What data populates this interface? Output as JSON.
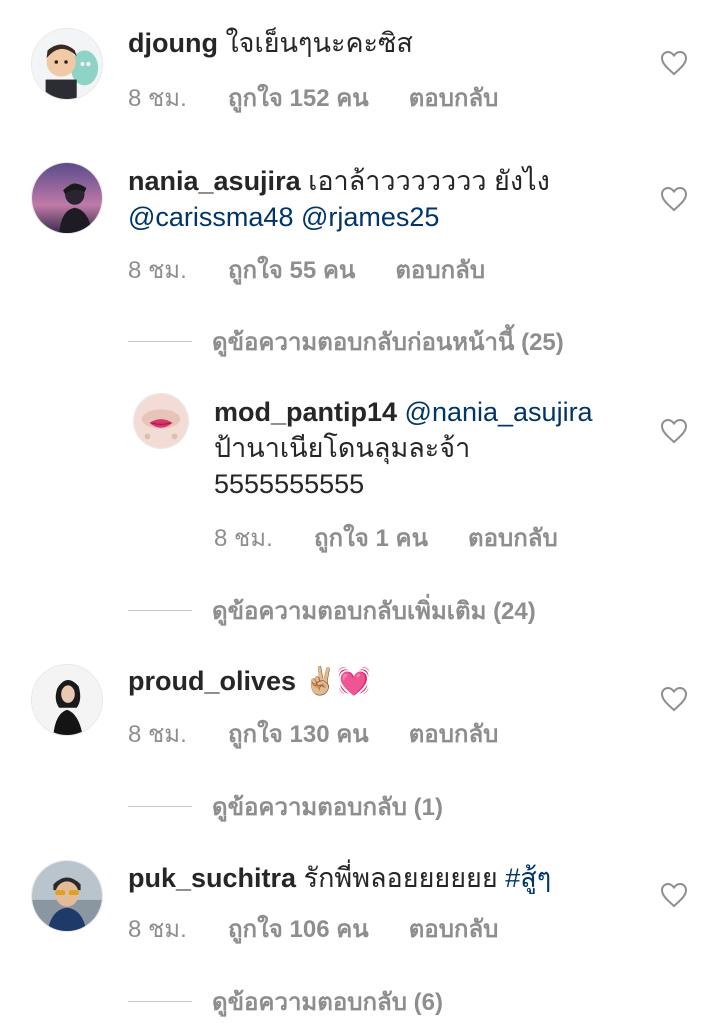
{
  "comments": [
    {
      "username": "djoung",
      "text": " ใจเย็นๆนะคะซิส",
      "time": "8 ชม.",
      "likes": "ถูกใจ 152 คน",
      "reply": "ตอบกลับ"
    },
    {
      "username": "nania_asujira",
      "text": " เอาล้าววววววว ยังไง",
      "mention1": "@carissma48",
      "mention2": "@rjames25",
      "time": "8 ชม.",
      "likes": "ถูกใจ 55 คน",
      "reply": "ตอบกลับ",
      "view_previous": "ดูข้อความตอบกลับก่อนหน้านี้ (25)"
    },
    {
      "username": "mod_pantip14",
      "mention": "@nania_asujira",
      "line2": "ป้านาเนียโดนลุมละจ้า",
      "line3": "5555555555",
      "time": "8 ชม.",
      "likes": "ถูกใจ 1 คน",
      "reply": "ตอบกลับ",
      "view_more": "ดูข้อความตอบกลับเพิ่มเติม (24)"
    },
    {
      "username": "proud_olives",
      "emoji": "✌🏼💓",
      "time": "8 ชม.",
      "likes": "ถูกใจ 130 คน",
      "reply": "ตอบกลับ",
      "view_replies": "ดูข้อความตอบกลับ (1)"
    },
    {
      "username": "puk_suchitra",
      "text": " รักพี่พลอยยยยยย ",
      "hashtag": "#สู้ๆ",
      "time": "8 ชม.",
      "likes": "ถูกใจ 106 คน",
      "reply": "ตอบกลับ",
      "view_replies": "ดูข้อความตอบกลับ (6)"
    }
  ],
  "colors": {
    "text": "#262626",
    "meta": "#8e8e8e",
    "mention": "#003569"
  },
  "icons": {
    "like": "heart-outline-icon"
  }
}
